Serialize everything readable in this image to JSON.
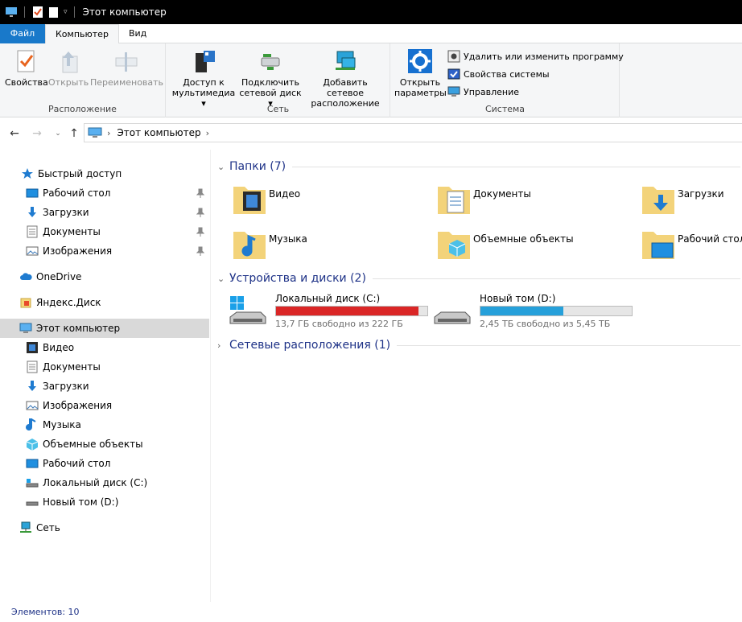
{
  "window": {
    "title": "Этот компьютер"
  },
  "ribbon": {
    "tabs": [
      "Файл",
      "Компьютер",
      "Вид"
    ],
    "groups": {
      "location": {
        "label": "Расположение",
        "buttons": [
          "Свойства",
          "Открыть",
          "Переименовать"
        ]
      },
      "network": {
        "label": "Сеть",
        "buttons": [
          {
            "line1": "Доступ к",
            "line2": "мультимедиа ▾"
          },
          {
            "line1": "Подключить",
            "line2": "сетевой диск ▾"
          },
          {
            "line1": "Добавить сетевое",
            "line2": "расположение"
          }
        ]
      },
      "system": {
        "label": "Система",
        "open_params": {
          "line1": "Открыть",
          "line2": "параметры"
        },
        "small": [
          "Удалить или изменить программу",
          "Свойства системы",
          "Управление"
        ]
      }
    }
  },
  "address": {
    "crumbs": [
      "Этот компьютер"
    ]
  },
  "navpane": {
    "items": [
      {
        "label": "Быстрый доступ",
        "icon": "star-icon",
        "pinned": false
      },
      {
        "label": "Рабочий стол",
        "icon": "desktop-icon",
        "pinned": true
      },
      {
        "label": "Загрузки",
        "icon": "download-arrow-icon",
        "pinned": true
      },
      {
        "label": "Документы",
        "icon": "document-icon",
        "pinned": true
      },
      {
        "label": "Изображения",
        "icon": "pictures-icon",
        "pinned": true
      },
      {
        "label": "OneDrive",
        "icon": "cloud-icon",
        "pinned": false
      },
      {
        "label": "Яндекс.Диск",
        "icon": "yandex-disk-icon",
        "pinned": false
      },
      {
        "label": "Этот компьютер",
        "icon": "computer-icon",
        "pinned": false
      },
      {
        "label": "Видео",
        "icon": "video-icon",
        "pinned": false
      },
      {
        "label": "Документы",
        "icon": "document-icon",
        "pinned": false
      },
      {
        "label": "Загрузки",
        "icon": "download-arrow-icon",
        "pinned": false
      },
      {
        "label": "Изображения",
        "icon": "pictures-icon",
        "pinned": false
      },
      {
        "label": "Музыка",
        "icon": "music-note-icon",
        "pinned": false
      },
      {
        "label": "Объемные объекты",
        "icon": "cube-icon",
        "pinned": false
      },
      {
        "label": "Рабочий стол",
        "icon": "desktop-icon",
        "pinned": false
      },
      {
        "label": "Локальный диск (C:)",
        "icon": "drive-icon",
        "pinned": false
      },
      {
        "label": "Новый том (D:)",
        "icon": "drive-icon",
        "pinned": false
      },
      {
        "label": "Сеть",
        "icon": "network-icon",
        "pinned": false
      }
    ]
  },
  "content": {
    "folders_header": "Папки (7)",
    "folders": [
      {
        "name": "Видео",
        "icon": "video-folder-icon"
      },
      {
        "name": "Документы",
        "icon": "documents-folder-icon"
      },
      {
        "name": "Загрузки",
        "icon": "downloads-folder-icon"
      },
      {
        "name": "Музыка",
        "icon": "music-folder-icon"
      },
      {
        "name": "Объемные объекты",
        "icon": "3d-objects-folder-icon"
      },
      {
        "name": "Рабочий стол",
        "icon": "desktop-folder-icon"
      }
    ],
    "drives_header": "Устройства и диски (2)",
    "drives": [
      {
        "name": "Локальный диск (C:)",
        "free": "13,7 ГБ свободно из 222 ГБ",
        "used_fraction": 0.94,
        "color": "#da2626"
      },
      {
        "name": "Новый том (D:)",
        "free": "2,45 ТБ свободно из 5,45 ТБ",
        "used_fraction": 0.55,
        "color": "#26a0da"
      }
    ],
    "network_header": "Сетевые расположения (1)"
  },
  "status": {
    "items_text": "Элементов: 10"
  }
}
